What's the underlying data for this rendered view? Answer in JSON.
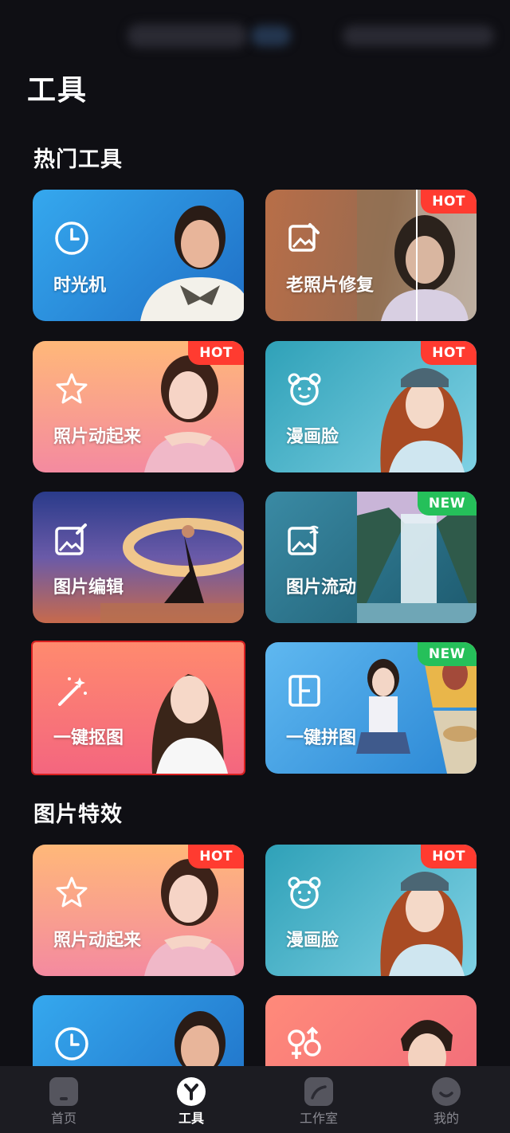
{
  "page": {
    "title": "工具"
  },
  "sections": [
    {
      "title": "热门工具"
    },
    {
      "title": "图片特效"
    }
  ],
  "cards": [
    {
      "label": "时光机",
      "icon": "clock-icon"
    },
    {
      "label": "老照片修复",
      "icon": "photo-repair-icon",
      "badge": "HOT"
    },
    {
      "label": "照片动起来",
      "icon": "sparkle-star-icon",
      "badge": "HOT"
    },
    {
      "label": "漫画脸",
      "icon": "bear-face-icon",
      "badge": "HOT"
    },
    {
      "label": "图片编辑",
      "icon": "photo-edit-icon"
    },
    {
      "label": "图片流动",
      "icon": "photo-flow-icon",
      "badge": "NEW"
    },
    {
      "label": "一键抠图",
      "icon": "magic-wand-icon"
    },
    {
      "label": "一键拼图",
      "icon": "collage-icon",
      "badge": "NEW"
    },
    {
      "label": "照片动起来",
      "icon": "sparkle-star-icon",
      "badge": "HOT"
    },
    {
      "label": "漫画脸",
      "icon": "bear-face-icon",
      "badge": "HOT"
    },
    {
      "label": "",
      "icon": "clock-icon"
    },
    {
      "label": "",
      "icon": "gender-swap-icon"
    }
  ],
  "bottom_nav": [
    {
      "label": "首页",
      "icon": "home-icon"
    },
    {
      "label": "工具",
      "icon": "tools-icon",
      "active": true
    },
    {
      "label": "工作室",
      "icon": "studio-icon"
    },
    {
      "label": "我的",
      "icon": "profile-icon"
    }
  ],
  "colors": {
    "background": "#0f0f14",
    "hot_badge": "#ff3b30",
    "new_badge": "#25c05a",
    "selected_outline": "#d92020"
  }
}
